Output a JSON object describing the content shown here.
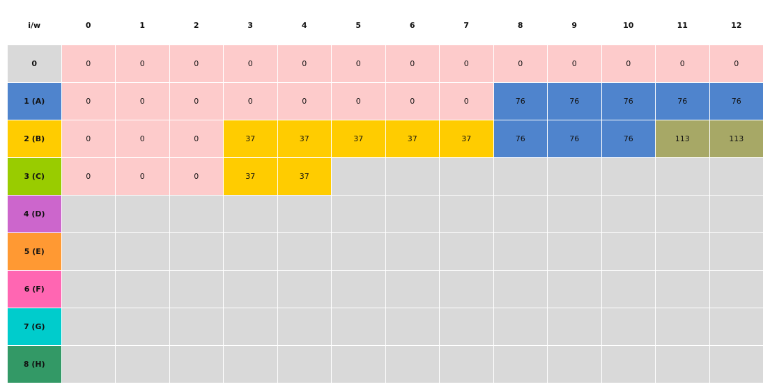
{
  "corner_label": "i/w",
  "columns": [
    "0",
    "1",
    "2",
    "3",
    "4",
    "5",
    "6",
    "7",
    "8",
    "9",
    "10",
    "11",
    "12"
  ],
  "empty_color": "#d9d9d9",
  "rows": [
    {
      "label": "0",
      "color": "#d9d9d9",
      "cells": [
        {
          "v": "0",
          "c": "#fdcbcb"
        },
        {
          "v": "0",
          "c": "#fdcbcb"
        },
        {
          "v": "0",
          "c": "#fdcbcb"
        },
        {
          "v": "0",
          "c": "#fdcbcb"
        },
        {
          "v": "0",
          "c": "#fdcbcb"
        },
        {
          "v": "0",
          "c": "#fdcbcb"
        },
        {
          "v": "0",
          "c": "#fdcbcb"
        },
        {
          "v": "0",
          "c": "#fdcbcb"
        },
        {
          "v": "0",
          "c": "#fdcbcb"
        },
        {
          "v": "0",
          "c": "#fdcbcb"
        },
        {
          "v": "0",
          "c": "#fdcbcb"
        },
        {
          "v": "0",
          "c": "#fdcbcb"
        },
        {
          "v": "0",
          "c": "#fdcbcb"
        }
      ]
    },
    {
      "label": "1 (A)",
      "color": "#4f84cd",
      "cells": [
        {
          "v": "0",
          "c": "#fdcbcb"
        },
        {
          "v": "0",
          "c": "#fdcbcb"
        },
        {
          "v": "0",
          "c": "#fdcbcb"
        },
        {
          "v": "0",
          "c": "#fdcbcb"
        },
        {
          "v": "0",
          "c": "#fdcbcb"
        },
        {
          "v": "0",
          "c": "#fdcbcb"
        },
        {
          "v": "0",
          "c": "#fdcbcb"
        },
        {
          "v": "0",
          "c": "#fdcbcb"
        },
        {
          "v": "76",
          "c": "#4f84cd"
        },
        {
          "v": "76",
          "c": "#4f84cd"
        },
        {
          "v": "76",
          "c": "#4f84cd"
        },
        {
          "v": "76",
          "c": "#4f84cd"
        },
        {
          "v": "76",
          "c": "#4f84cd"
        }
      ]
    },
    {
      "label": "2 (B)",
      "color": "#ffcc00",
      "cells": [
        {
          "v": "0",
          "c": "#fdcbcb"
        },
        {
          "v": "0",
          "c": "#fdcbcb"
        },
        {
          "v": "0",
          "c": "#fdcbcb"
        },
        {
          "v": "37",
          "c": "#ffcc00"
        },
        {
          "v": "37",
          "c": "#ffcc00"
        },
        {
          "v": "37",
          "c": "#ffcc00"
        },
        {
          "v": "37",
          "c": "#ffcc00"
        },
        {
          "v": "37",
          "c": "#ffcc00"
        },
        {
          "v": "76",
          "c": "#4f84cd"
        },
        {
          "v": "76",
          "c": "#4f84cd"
        },
        {
          "v": "76",
          "c": "#4f84cd"
        },
        {
          "v": "113",
          "c": "#a7a866"
        },
        {
          "v": "113",
          "c": "#a7a866"
        }
      ]
    },
    {
      "label": "3 (C)",
      "color": "#99cc00",
      "cells": [
        {
          "v": "0",
          "c": "#fdcbcb"
        },
        {
          "v": "0",
          "c": "#fdcbcb"
        },
        {
          "v": "0",
          "c": "#fdcbcb"
        },
        {
          "v": "37",
          "c": "#ffcc00"
        },
        {
          "v": "37",
          "c": "#ffcc00"
        },
        {
          "v": "",
          "c": "#d9d9d9"
        },
        {
          "v": "",
          "c": "#d9d9d9"
        },
        {
          "v": "",
          "c": "#d9d9d9"
        },
        {
          "v": "",
          "c": "#d9d9d9"
        },
        {
          "v": "",
          "c": "#d9d9d9"
        },
        {
          "v": "",
          "c": "#d9d9d9"
        },
        {
          "v": "",
          "c": "#d9d9d9"
        },
        {
          "v": "",
          "c": "#d9d9d9"
        }
      ]
    },
    {
      "label": "4 (D)",
      "color": "#cc66cc",
      "cells": []
    },
    {
      "label": "5 (E)",
      "color": "#ff9933",
      "cells": []
    },
    {
      "label": "6 (F)",
      "color": "#ff66b2",
      "cells": []
    },
    {
      "label": "7 (G)",
      "color": "#00cccc",
      "cells": []
    },
    {
      "label": "8 (H)",
      "color": "#339966",
      "cells": []
    }
  ]
}
